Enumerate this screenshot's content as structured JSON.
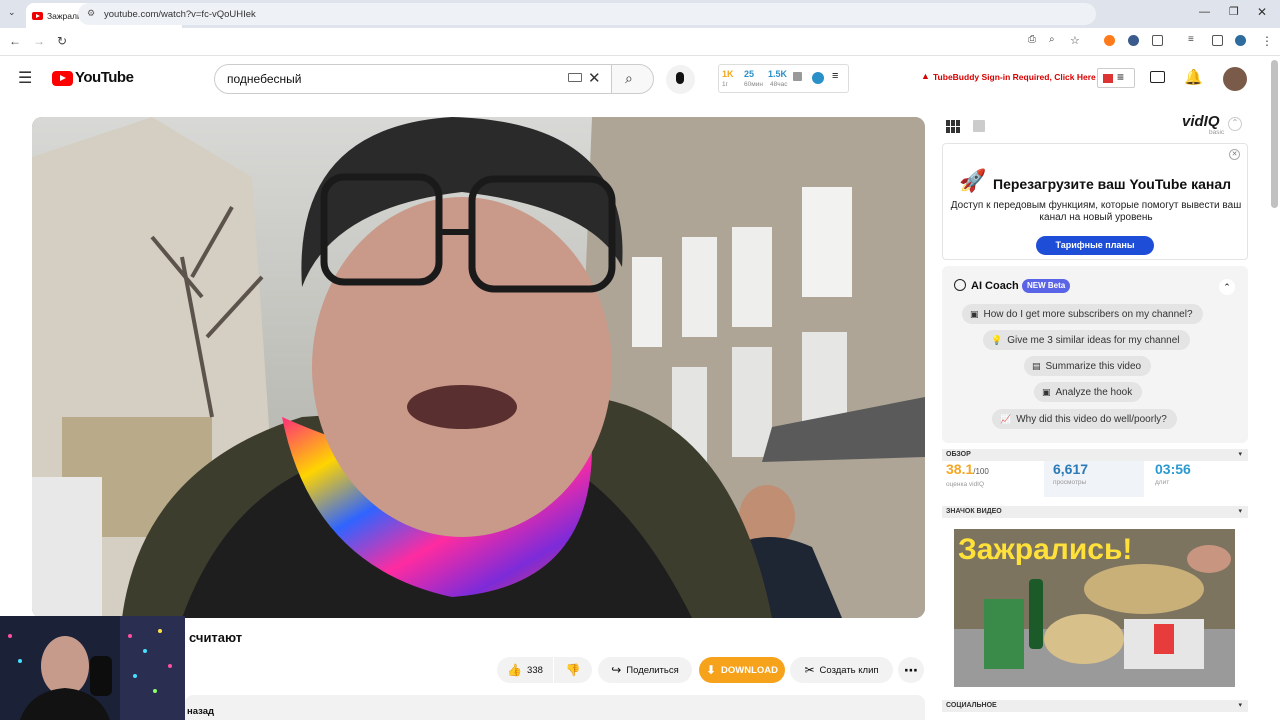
{
  "browser": {
    "tab_title": "Зажрались и денег не считают",
    "url": "youtube.com/watch?v=fc-vQoUHIek"
  },
  "youtube": {
    "logo_text": "YouTube",
    "search_value": "поднебесный",
    "tubebuddy_stats": {
      "subs": "1K",
      "subs_sub": "1г",
      "videos": "25",
      "videos_sub": "60мин",
      "views": "1.5K",
      "views_sub": "48час"
    },
    "tubebuddy_warning": "TubeBuddy Sign-in Required, Click Here"
  },
  "video": {
    "title": "считают",
    "like_count": "338",
    "share_label": "Поделиться",
    "download_label": "DOWNLOAD",
    "clip_label": "Создать клип",
    "description_text": "назад"
  },
  "vidiq": {
    "logo": "vidIQ",
    "plan": "basic",
    "promo_title": "Перезагрузите ваш YouTube канал",
    "promo_text": "Доступ к передовым функциям, которые помогут вывести ваш канал на новый уровень",
    "promo_button": "Тарифные планы",
    "ai_coach_title": "AI Coach",
    "ai_coach_badge": "NEW Beta",
    "questions": [
      "How do I get more subscribers on my channel?",
      "Give me 3 similar ideas for my channel",
      "Summarize this video",
      "Analyze the hook",
      "Why did this video do well/poorly?"
    ],
    "overview_label": "ОБЗОР",
    "score": "38.1",
    "score_max": "/100",
    "score_label": "оценка vidIQ",
    "views": "6,617",
    "views_label": "просмотры",
    "duration": "03:56",
    "duration_label": "длит",
    "thumbnail_label": "ЗНАЧОК ВИДЕО",
    "thumbnail_text": "Зажрались!",
    "social_label": "СОЦИАЛЬНОЕ"
  },
  "colors": {
    "youtube_red": "#ff0000",
    "download_orange": "#f7a21b",
    "vidiq_blue": "#1e4ed8",
    "score_orange": "#f5a623",
    "stat_blue": "#2a7ab8"
  }
}
